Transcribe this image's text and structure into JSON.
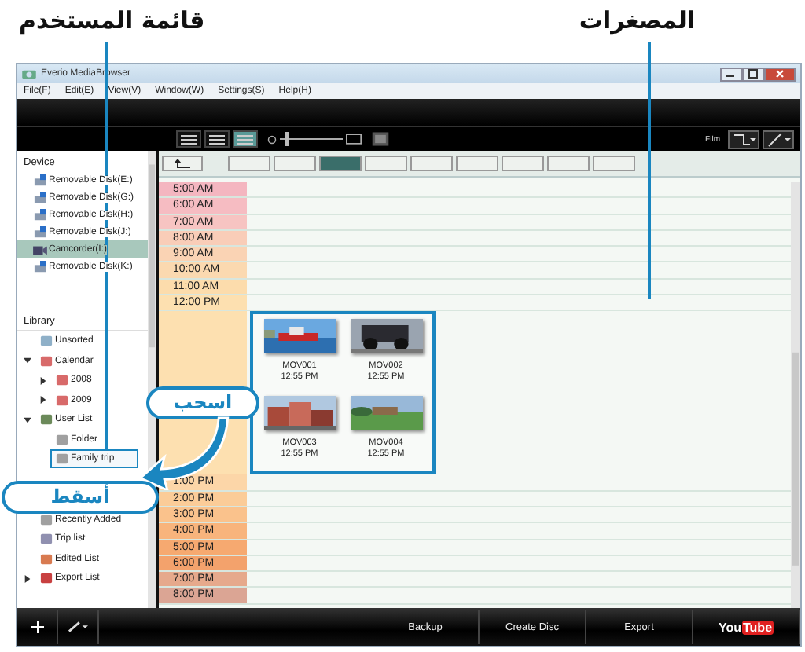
{
  "annotations": {
    "user_list": "قائمة المستخدم",
    "thumbnails": "المصغرات",
    "drag": "اسحب",
    "drop": "أسقط"
  },
  "window": {
    "title": "Everio MediaBrowser"
  },
  "menu": [
    "File(F)",
    "Edit(E)",
    "View(V)",
    "Window(W)",
    "Settings(S)",
    "Help(H)"
  ],
  "view_modes": [
    {
      "selected": false
    },
    {
      "selected": false
    },
    {
      "selected": true
    }
  ],
  "zoom": {
    "level": 0.1
  },
  "filter_label": "Film",
  "nav_buttons": [
    {
      "selected": false
    },
    {
      "selected": false
    },
    {
      "selected": true
    },
    {
      "selected": false
    },
    {
      "selected": false
    },
    {
      "selected": false
    },
    {
      "selected": false
    },
    {
      "selected": false
    },
    {
      "selected": false
    }
  ],
  "sidebar": {
    "device_heading": "Device",
    "devices": [
      {
        "name": "Removable Disk(E:)",
        "kind": "disk",
        "selected": false
      },
      {
        "name": "Removable Disk(G:)",
        "kind": "disk",
        "selected": false
      },
      {
        "name": "Removable Disk(H:)",
        "kind": "disk",
        "selected": false
      },
      {
        "name": "Removable Disk(J:)",
        "kind": "disk",
        "selected": false
      },
      {
        "name": "Camcorder(I:)",
        "kind": "camcorder",
        "selected": true
      },
      {
        "name": "Removable Disk(K:)",
        "kind": "disk",
        "selected": false
      }
    ],
    "library_heading": "Library",
    "library": [
      {
        "name": "Unsorted",
        "kind": "unsorted"
      },
      {
        "name": "Calendar",
        "kind": "calendar",
        "expanded": true,
        "children": [
          {
            "name": "2008",
            "kind": "calendar",
            "expanded": false
          },
          {
            "name": "2009",
            "kind": "calendar",
            "expanded": false
          }
        ]
      },
      {
        "name": "User List",
        "kind": "userlist",
        "expanded": true,
        "children": [
          {
            "name": "Folder",
            "kind": "list",
            "highlighted": false
          },
          {
            "name": "Family trip",
            "kind": "list",
            "highlighted": true
          }
        ]
      },
      {
        "name": "Recently Added",
        "kind": "list"
      },
      {
        "name": "Trip list",
        "kind": "search"
      },
      {
        "name": "Edited List",
        "kind": "edited"
      },
      {
        "name": "Export List",
        "kind": "export",
        "expanded": false
      }
    ]
  },
  "timeline": {
    "morning": [
      "5:00 AM",
      "6:00 AM",
      "7:00 AM",
      "8:00 AM",
      "9:00 AM",
      "10:00 AM",
      "11:00 AM",
      "12:00 PM"
    ],
    "thumbnails": [
      {
        "name": "MOV001",
        "time": "12:55 PM",
        "kind": "boat"
      },
      {
        "name": "MOV002",
        "time": "12:55 PM",
        "kind": "car"
      },
      {
        "name": "MOV003",
        "time": "12:55 PM",
        "kind": "town"
      },
      {
        "name": "MOV004",
        "time": "12:55 PM",
        "kind": "field"
      }
    ],
    "afternoon": [
      "1:00 PM",
      "2:00 PM",
      "3:00 PM",
      "4:00 PM",
      "5:00 PM",
      "6:00 PM",
      "7:00 PM",
      "8:00 PM"
    ]
  },
  "bottom_bar": {
    "buttons": [
      "Backup",
      "Create Disc",
      "Export"
    ],
    "youtube": {
      "you": "You",
      "tube": "Tube"
    }
  }
}
